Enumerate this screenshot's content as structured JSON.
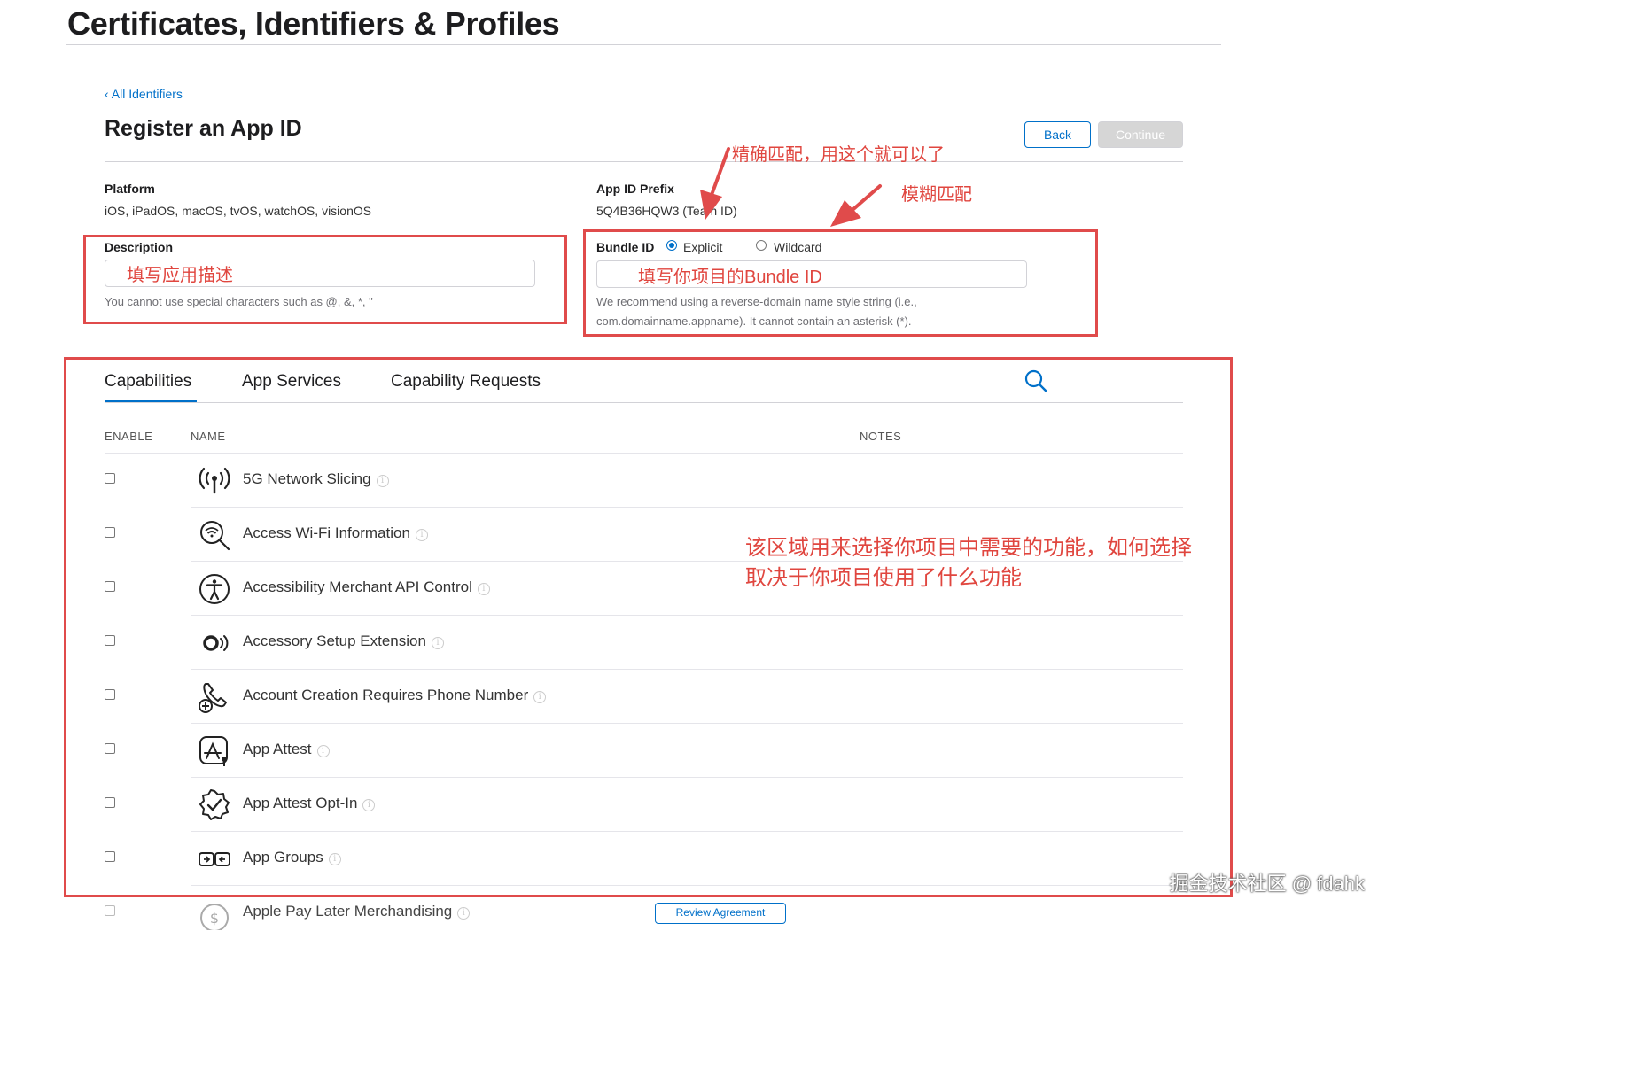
{
  "header": {
    "title": "Certificates, Identifiers & Profiles"
  },
  "nav": {
    "back_link": "‹ All Identifiers"
  },
  "form": {
    "title": "Register an App ID",
    "back_button": "Back",
    "continue_button": "Continue",
    "platform": {
      "label": "Platform",
      "value": "iOS, iPadOS, macOS, tvOS, watchOS, visionOS"
    },
    "app_id_prefix": {
      "label": "App ID Prefix",
      "value": "5Q4B36HQW3 (Team ID)"
    },
    "description": {
      "label": "Description",
      "value": "",
      "hint": "You cannot use special characters such as @, &, *, \""
    },
    "bundle_id": {
      "label": "Bundle ID",
      "options": [
        "Explicit",
        "Wildcard"
      ],
      "selected": "Explicit",
      "value": "",
      "hint_line1": "We recommend using a reverse-domain name style string (i.e.,",
      "hint_line2": "com.domainname.appname). It cannot contain an asterisk (*)."
    }
  },
  "tabs": [
    {
      "label": "Capabilities",
      "active": true
    },
    {
      "label": "App Services",
      "active": false
    },
    {
      "label": "Capability Requests",
      "active": false
    }
  ],
  "table": {
    "headers": {
      "enable": "ENABLE",
      "name": "NAME",
      "notes": "NOTES"
    },
    "rows": [
      {
        "name": "5G Network Slicing",
        "icon": "antenna-icon",
        "enabled": false
      },
      {
        "name": "Access Wi-Fi Information",
        "icon": "wifi-search-icon",
        "enabled": false
      },
      {
        "name": "Accessibility Merchant API Control",
        "icon": "accessibility-icon",
        "enabled": false
      },
      {
        "name": "Accessory Setup Extension",
        "icon": "accessory-icon",
        "enabled": false
      },
      {
        "name": "Account Creation Requires Phone Number",
        "icon": "phone-add-icon",
        "enabled": false
      },
      {
        "name": "App Attest",
        "icon": "app-attest-icon",
        "enabled": false
      },
      {
        "name": "App Attest Opt-In",
        "icon": "verified-badge-icon",
        "enabled": false
      },
      {
        "name": "App Groups",
        "icon": "app-groups-icon",
        "enabled": false
      },
      {
        "name": "Apple Pay Later Merchandising",
        "icon": "dollar-icon",
        "enabled": false,
        "notes_button": "Review Agreement"
      }
    ]
  },
  "annotations": {
    "explicit_note": "精确匹配，用这个就可以了",
    "wildcard_note": "模糊匹配",
    "description_note": "填写应用描述",
    "bundle_note": "填写你项目的Bundle ID",
    "capabilities_note_line1": "该区域用来选择你项目中需要的功能，如何选择",
    "capabilities_note_line2": "取决于你项目使用了什么功能"
  },
  "watermark": "掘金技术社区 @ fdahk",
  "colors": {
    "accent": "#0070c9",
    "annotation_red": "#e04b4b",
    "text": "#1d1d1f"
  }
}
